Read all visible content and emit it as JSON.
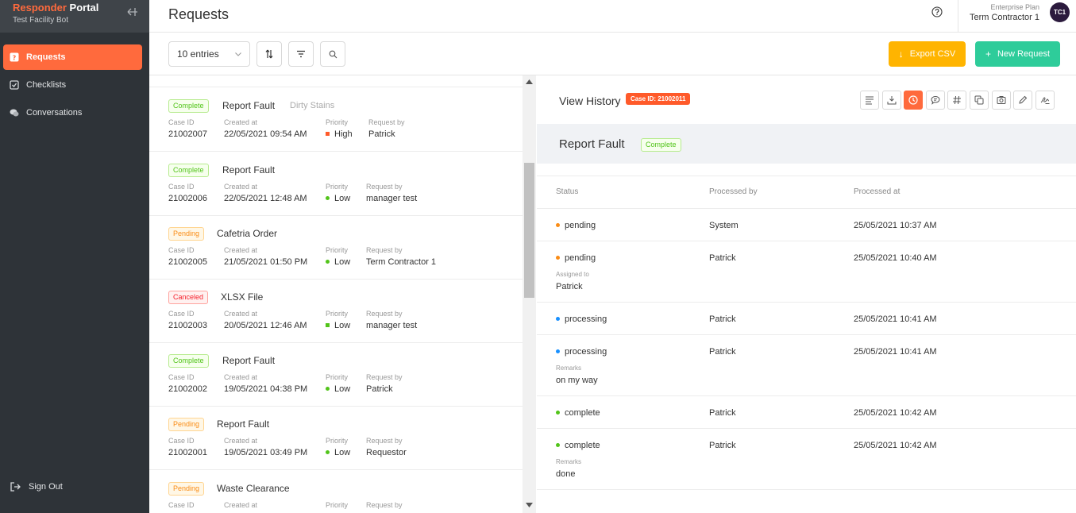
{
  "sidebar": {
    "brand_1": "Responder",
    "brand_2": "Portal",
    "subtitle": "Test Facility Bot",
    "items": [
      {
        "label": "Requests",
        "icon": "question-square-icon",
        "active": true
      },
      {
        "label": "Checklists",
        "icon": "checklist-icon",
        "active": false
      },
      {
        "label": "Conversations",
        "icon": "chat-icon",
        "active": false
      }
    ],
    "signout": "Sign Out"
  },
  "header": {
    "title": "Requests",
    "plan": "Enterprise Plan",
    "user": "Term Contractor 1",
    "avatar": "TC1"
  },
  "toolbar": {
    "entries": "10 entries",
    "export_label": "Export CSV",
    "new_label": "New Request"
  },
  "colors": {
    "accent": "#ff6a3d",
    "export": "#ffb400",
    "new": "#2ecc9a",
    "high": "#ff5a2a",
    "low": "#52c41a",
    "pending_dot": "#fa8c16",
    "processing_dot": "#1890ff",
    "complete_dot": "#52c41a"
  },
  "list": {
    "labels": {
      "case": "Case ID",
      "created": "Created at",
      "priority": "Priority",
      "by": "Request by"
    },
    "items": [
      {
        "status": "Complete",
        "title": "Report Fault",
        "sub": "Dirty Stains",
        "case": "21002007",
        "created": "22/05/2021 09:54 AM",
        "priority": "High",
        "by": "Patrick"
      },
      {
        "status": "Complete",
        "title": "Report Fault",
        "sub": "",
        "case": "21002006",
        "created": "22/05/2021 12:48 AM",
        "priority": "Low",
        "by": "manager test"
      },
      {
        "status": "Pending",
        "title": "Cafetria Order",
        "sub": "",
        "case": "21002005",
        "created": "21/05/2021 01:50 PM",
        "priority": "Low",
        "by": "Term Contractor 1"
      },
      {
        "status": "Canceled",
        "title": "XLSX File",
        "sub": "",
        "case": "21002003",
        "created": "20/05/2021 12:46 AM",
        "priority": "Low",
        "by": "manager test"
      },
      {
        "status": "Complete",
        "title": "Report Fault",
        "sub": "",
        "case": "21002002",
        "created": "19/05/2021 04:38 PM",
        "priority": "Low",
        "by": "Patrick"
      },
      {
        "status": "Pending",
        "title": "Report Fault",
        "sub": "",
        "case": "21002001",
        "created": "19/05/2021 03:49 PM",
        "priority": "Low",
        "by": "Requestor"
      },
      {
        "status": "Pending",
        "title": "Waste Clearance",
        "sub": "",
        "case": "",
        "created": "",
        "priority": "",
        "by": ""
      }
    ]
  },
  "detail": {
    "title": "View History",
    "case_badge": "Case ID: 21002011",
    "request_title": "Report Fault",
    "request_status": "Complete",
    "columns": [
      "Status",
      "Processed by",
      "Processed at"
    ],
    "rows": [
      {
        "status": "pending",
        "by": "System",
        "at": "25/05/2021 10:37 AM",
        "sub_label": "",
        "sub_value": ""
      },
      {
        "status": "pending",
        "by": "Patrick",
        "at": "25/05/2021 10:40 AM",
        "sub_label": "Assigned to",
        "sub_value": "Patrick"
      },
      {
        "status": "processing",
        "by": "Patrick",
        "at": "25/05/2021 10:41 AM",
        "sub_label": "",
        "sub_value": ""
      },
      {
        "status": "processing",
        "by": "Patrick",
        "at": "25/05/2021 10:41 AM",
        "sub_label": "Remarks",
        "sub_value": "on my way"
      },
      {
        "status": "complete",
        "by": "Patrick",
        "at": "25/05/2021 10:42 AM",
        "sub_label": "",
        "sub_value": ""
      },
      {
        "status": "complete",
        "by": "Patrick",
        "at": "25/05/2021 10:42 AM",
        "sub_label": "Remarks",
        "sub_value": "done"
      }
    ]
  }
}
